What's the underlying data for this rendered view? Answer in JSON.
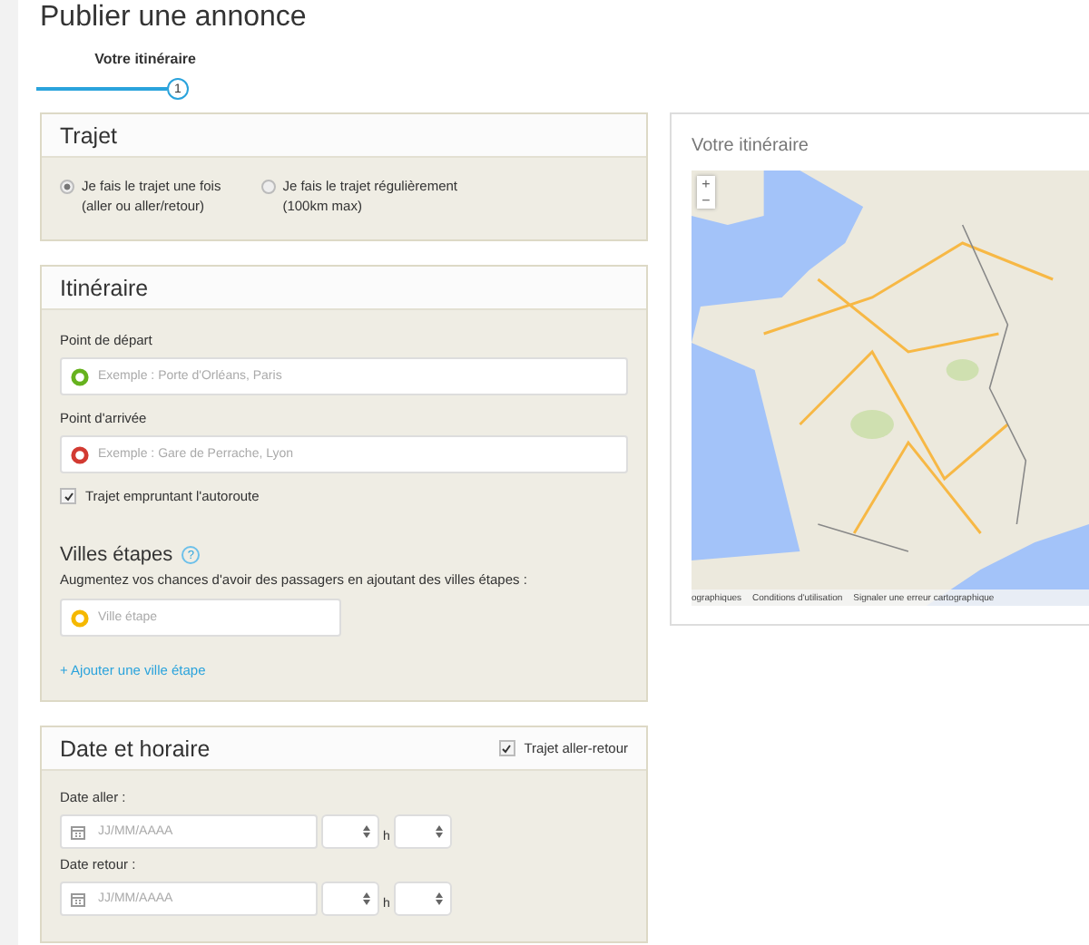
{
  "page": {
    "title": "Publier une annonce"
  },
  "steps": [
    {
      "label": "Votre itinéraire",
      "number": "1",
      "selected": true
    }
  ],
  "trajet": {
    "title": "Trajet",
    "options": [
      {
        "label": "Je fais le trajet une fois",
        "sublabel": "(aller ou aller/retour)",
        "selected": true
      },
      {
        "label": "Je fais le trajet régulièrement",
        "sublabel": "(100km max)",
        "selected": false
      }
    ]
  },
  "itineraire": {
    "title": "Itinéraire",
    "fields": [
      {
        "label": "Point de départ",
        "placeholder": "Exemple : Porte d'Orléans, Paris",
        "color": "#66b21e"
      },
      {
        "label": "Point d'arrivée",
        "placeholder": "Exemple : Gare de Perrache, Lyon",
        "color": "#d23a32"
      }
    ],
    "highway": {
      "label": "Trajet empruntant l'autoroute",
      "checked": true
    },
    "stops": {
      "title": "Villes étapes",
      "help": "?",
      "text": "Augmentez vos chances d'avoir des passagers en ajoutant des villes étapes :",
      "field": {
        "placeholder": "Ville étape",
        "color": "#f5b800"
      },
      "add_link": "+ Ajouter une ville étape"
    }
  },
  "schedule": {
    "title": "Date et horaire",
    "round_trip": {
      "label": "Trajet aller-retour",
      "checked": true
    },
    "dates": [
      {
        "label": "Date aller :",
        "placeholder": "JJ/MM/AAAA",
        "separator": "h"
      },
      {
        "label": "Date retour :",
        "placeholder": "JJ/MM/AAAA",
        "separator": "h"
      }
    ]
  },
  "map_panel": {
    "title": "Votre itinéraire",
    "zoom_in": "+",
    "zoom_out": "−",
    "footer": [
      "ographiques",
      "Conditions d'utilisation",
      "Signaler une erreur cartographique"
    ]
  }
}
